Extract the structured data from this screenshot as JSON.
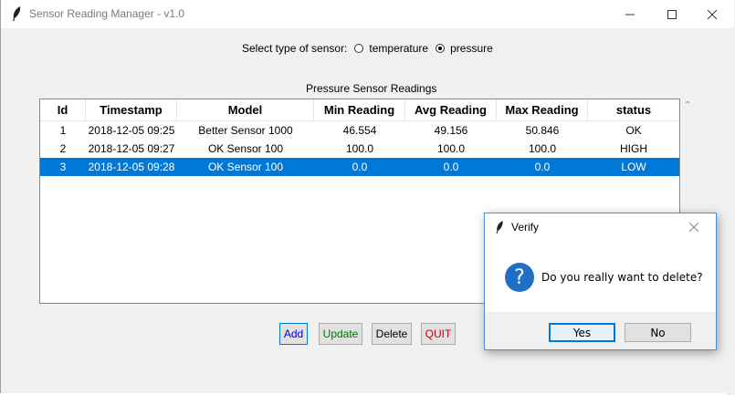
{
  "window": {
    "title": "Sensor Reading Manager - v1.0"
  },
  "sensor_select": {
    "label": "Select type of sensor:",
    "options": [
      "temperature",
      "pressure"
    ],
    "selected": "pressure"
  },
  "table": {
    "caption": "Pressure Sensor Readings",
    "columns": [
      "Id",
      "Timestamp",
      "Model",
      "Min Reading",
      "Avg Reading",
      "Max Reading",
      "status"
    ],
    "rows": [
      [
        "1",
        "2018-12-05 09:25",
        "Better Sensor 1000",
        "46.554",
        "49.156",
        "50.846",
        "OK"
      ],
      [
        "2",
        "2018-12-05 09:27",
        "OK Sensor 100",
        "100.0",
        "100.0",
        "100.0",
        "HIGH"
      ],
      [
        "3",
        "2018-12-05 09:28",
        "OK Sensor 100",
        "0.0",
        "0.0",
        "0.0",
        "LOW"
      ]
    ],
    "selected_row": 2
  },
  "buttons": {
    "add": "Add",
    "update": "Update",
    "delete": "Delete",
    "quit": "QUIT"
  },
  "button_colors": {
    "add": "#0000cc",
    "update": "#007700",
    "quit": "#cc0000"
  },
  "dialog": {
    "title": "Verify",
    "message": "Do you really want to delete?",
    "icon": "question-icon",
    "yes": "Yes",
    "no": "No"
  }
}
